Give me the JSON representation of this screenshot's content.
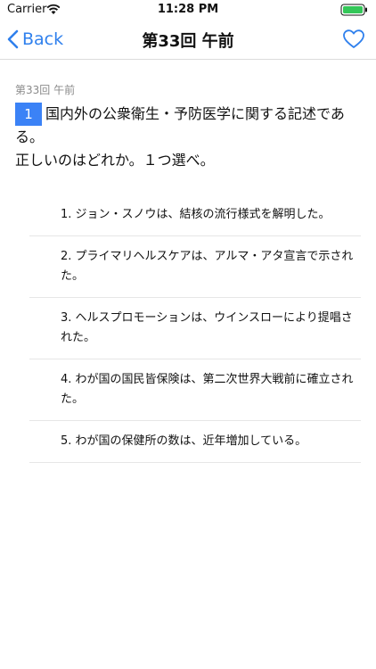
{
  "status_bar": {
    "carrier": "Carrier",
    "time": "11:28 PM",
    "battery_color": "#34c759"
  },
  "nav": {
    "back_label": "Back",
    "title": "第33回 午前",
    "accent": "#2f80ed"
  },
  "question": {
    "session": "第33回 午前",
    "number": "1",
    "text": "国内外の公衆衛生・予防医学に関する記述である。",
    "instruction": "正しいのはどれか。１つ選べ。"
  },
  "options": [
    {
      "label": "1. ジョン・スノウは、結核の流行様式を解明した。"
    },
    {
      "label": "2. プライマリヘルスケアは、アルマ・アタ宣言で示された。"
    },
    {
      "label": "3. ヘルスプロモーションは、ウインスローにより提唱された。"
    },
    {
      "label": "4. わが国の国民皆保険は、第二次世界大戦前に確立された。"
    },
    {
      "label": "5. わが国の保健所の数は、近年増加している。"
    }
  ]
}
